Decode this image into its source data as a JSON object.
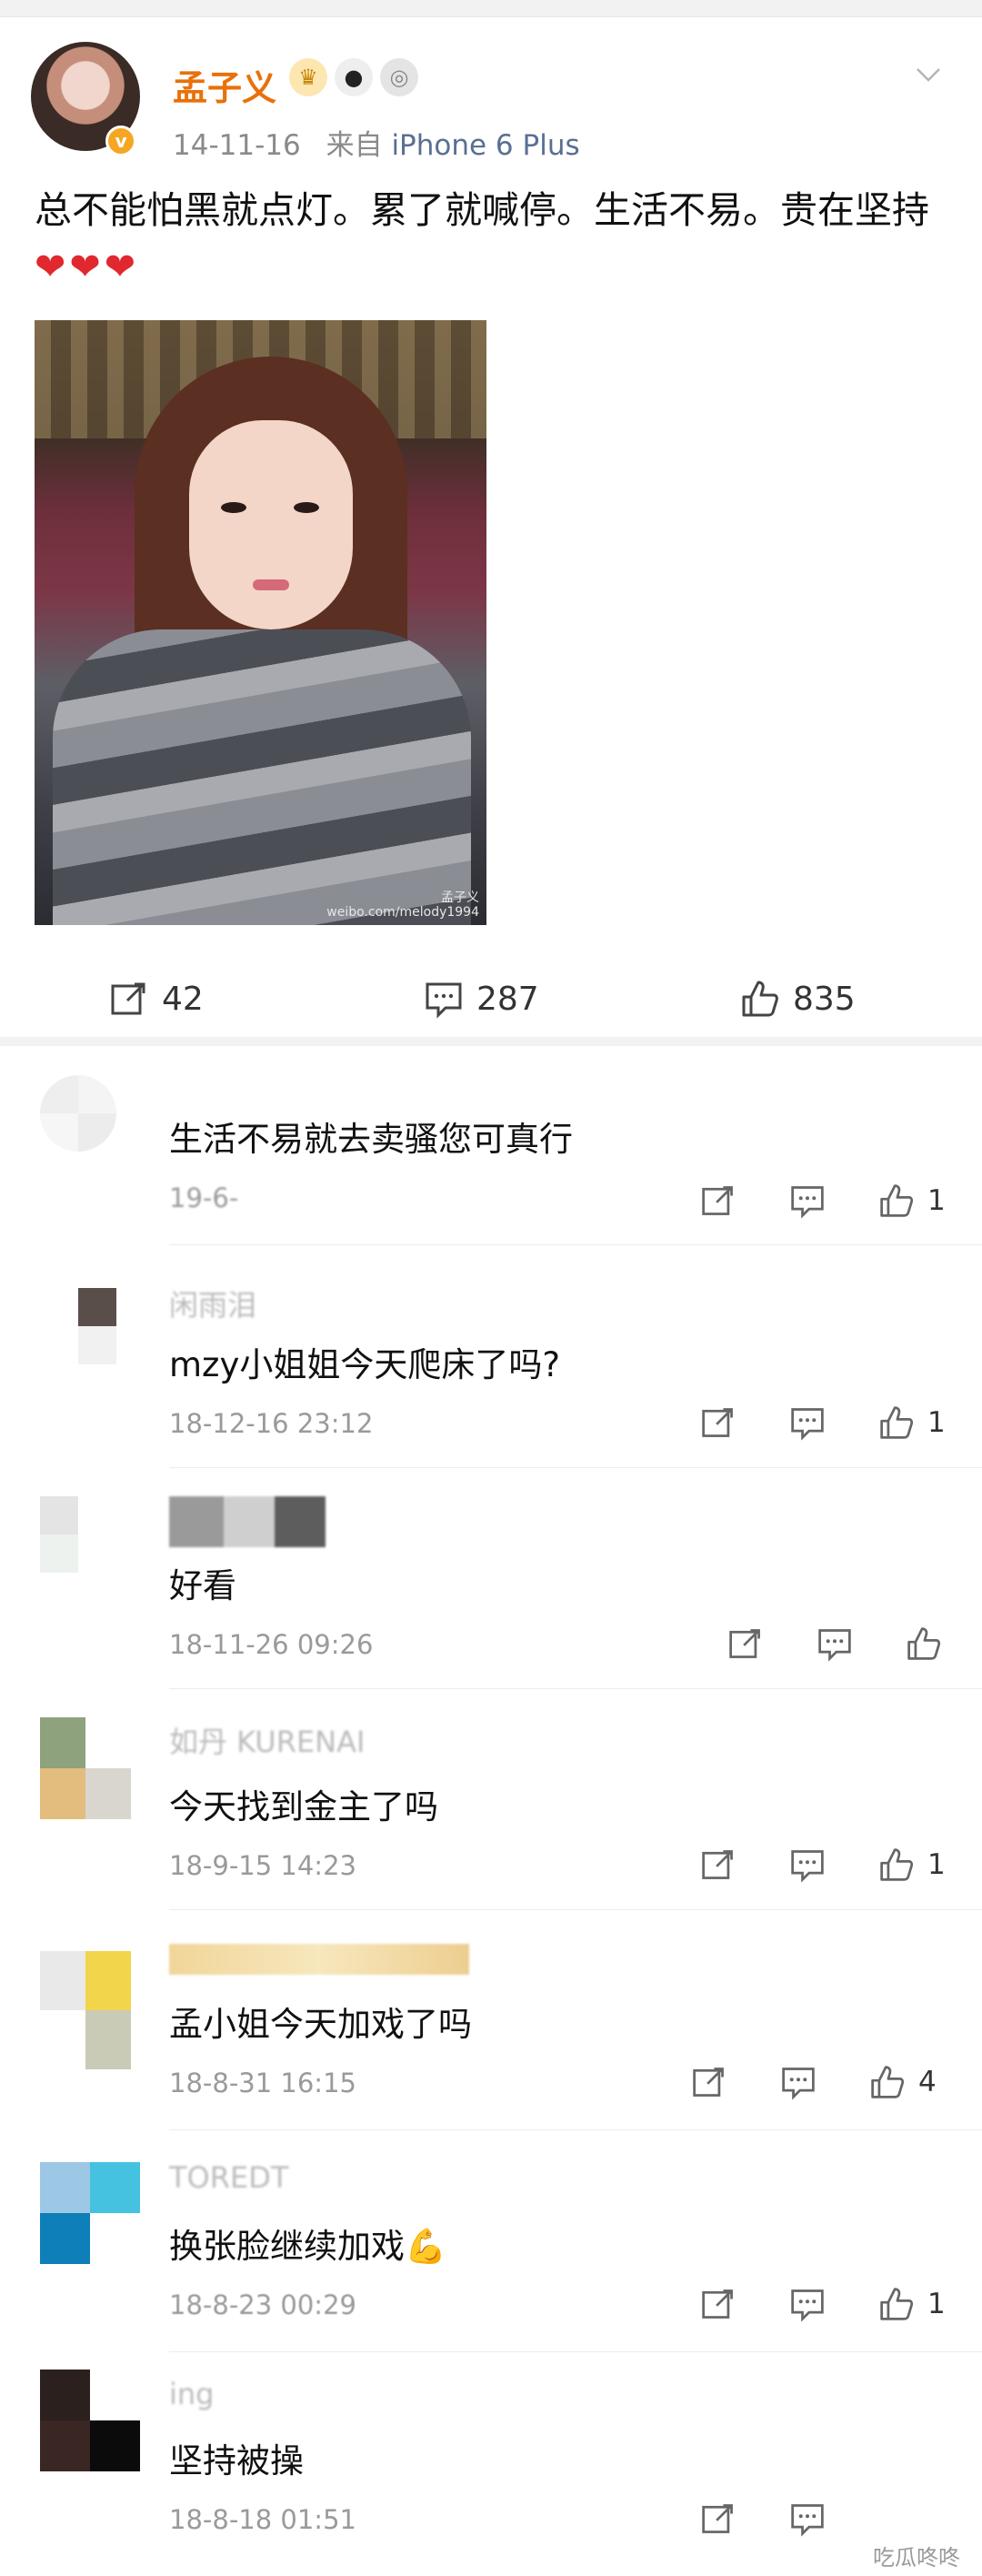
{
  "post": {
    "username": "孟子义",
    "verified_mark": "v",
    "badges": [
      "crown-badge",
      "panda-badge",
      "medal-badge"
    ],
    "date": "14-11-16",
    "source_prefix": "来自",
    "source": "iPhone 6 Plus",
    "text": "总不能怕黑就点灯。累了就喊停。生活不易。贵在坚持",
    "hearts": "❤❤❤",
    "image_watermark_line1": "孟子义",
    "image_watermark_line2": "weibo.com/melody1994",
    "reposts": "42",
    "comments": "287",
    "likes": "835"
  },
  "comments": [
    {
      "name": "",
      "text": "生活不易就去卖骚您可真行",
      "time": "19-6-",
      "likes": "1"
    },
    {
      "name": "闲雨泪",
      "text": "mzy小姐姐今天爬床了吗?",
      "time": "18-12-16 23:12",
      "likes": "1"
    },
    {
      "name": "",
      "text": "好看",
      "time": "18-11-26 09:26",
      "likes": ""
    },
    {
      "name": "如丹 KURENAI",
      "text": "今天找到金主了吗",
      "time": "18-9-15 14:23",
      "likes": "1"
    },
    {
      "name": "",
      "text": "孟小姐今天加戏了吗",
      "time": "18-8-31 16:15",
      "likes": "4"
    },
    {
      "name": "TOREDT",
      "text": "换张脸继续加戏💪",
      "time": "18-8-23 00:29",
      "likes": "1"
    },
    {
      "name": "ing",
      "text": "坚持被操",
      "time": "18-8-18 01:51",
      "likes": ""
    }
  ],
  "watermark": "吃瓜咚咚",
  "colors": {
    "username": "#e8710a",
    "source": "#5a6f93",
    "heart": "#e0282e"
  }
}
